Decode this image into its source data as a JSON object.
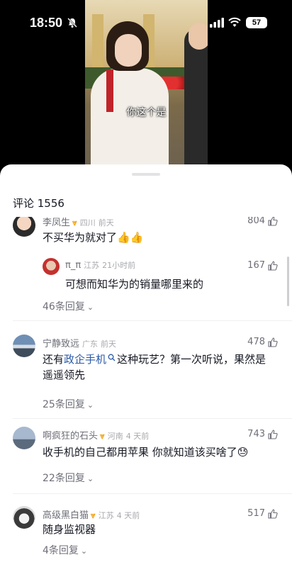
{
  "status": {
    "time": "18:50",
    "battery": "57"
  },
  "video": {
    "subtitle": "你这个是"
  },
  "comments_panel": {
    "title": "评论 1556"
  },
  "comments": [
    {
      "user": "李凤生",
      "location": "四川",
      "time": "前天",
      "text": "不买华为就对了👍👍",
      "likes": "804",
      "reply": {
        "user": "π_π",
        "location": "江苏",
        "time": "21小时前",
        "text": "可想而知华为的销量哪里来的",
        "likes": "167"
      },
      "replies_label": "46条回复"
    },
    {
      "user": "宁静致远",
      "location": "广东",
      "time": "前天",
      "text_prefix": "还有",
      "text_link": "政企手机",
      "text_suffix": "这种玩艺？第一次听说，果然是遥遥领先",
      "likes": "478",
      "replies_label": "25条回复"
    },
    {
      "user": "啊疯狂的石头",
      "location": "河南",
      "time": "4 天前",
      "text": "收手机的自己都用苹果 你就知道该买啥了😓",
      "likes": "743",
      "replies_label": "22条回复"
    },
    {
      "user": "高级黑白猫",
      "location": "江苏",
      "time": "4 天前",
      "text": "随身监视器",
      "likes": "517",
      "replies_label": "4条回复"
    }
  ],
  "colors": {
    "badge": "#f4a51c",
    "link": "#2a5aa8",
    "muted": "#6e6f78"
  },
  "icons": [
    "bell-muted-icon",
    "signal-icon",
    "wifi-icon",
    "battery-icon",
    "thumb-up-icon",
    "chevron-down-icon",
    "search-icon",
    "badge-icon"
  ]
}
